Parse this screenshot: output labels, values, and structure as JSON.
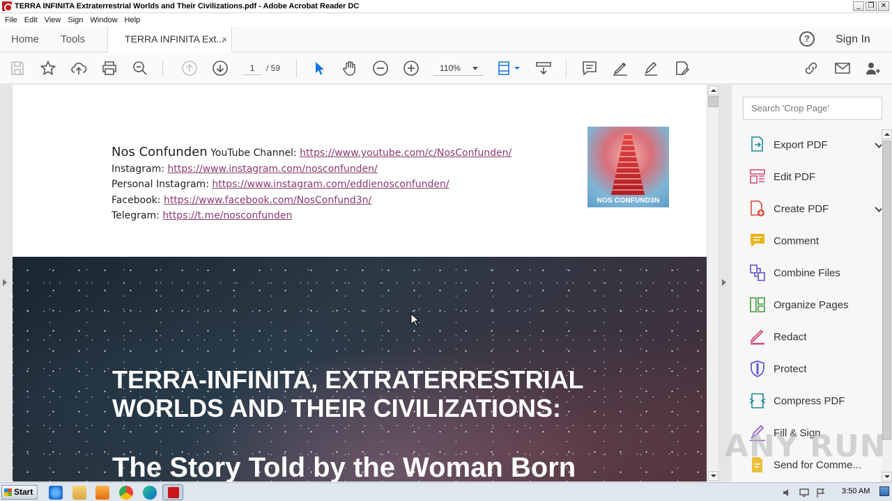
{
  "window": {
    "title": "TERRA INFINITA Extraterrestrial Worlds and Their Civilizations.pdf - Adobe Acrobat Reader DC",
    "buttons": {
      "minimize": "_",
      "restore": "❐",
      "close": "✕"
    }
  },
  "menu": [
    "File",
    "Edit",
    "View",
    "Sign",
    "Window",
    "Help"
  ],
  "tabs": {
    "home": "Home",
    "tools": "Tools",
    "document": "TERRA INFINITA Ext...",
    "close_glyph": "×"
  },
  "header": {
    "help_glyph": "?",
    "sign_in": "Sign In"
  },
  "toolbar": {
    "page_current": "1",
    "page_total": "/ 59",
    "zoom": "110%",
    "icons": [
      "save-icon",
      "bookmark-star-icon",
      "upload-cloud-icon",
      "print-icon",
      "zoom-search-icon",
      "page-up-icon",
      "page-down-icon",
      "select-arrow-icon",
      "hand-icon",
      "zoom-out-icon",
      "zoom-in-icon",
      "fit-page-icon",
      "scroll-mode-icon",
      "comment-icon",
      "highlight-icon",
      "sign-icon",
      "share-edit-icon",
      "link-icon",
      "email-icon",
      "add-user-icon"
    ]
  },
  "document": {
    "brand": "Nos Confunden",
    "youtube_label": " YouTube Channel: ",
    "youtube_url": "https://www.youtube.com/c/NosConfunden/",
    "instagram_label": "Instagram: ",
    "instagram_url": "https://www.instagram.com/nosconfunden/",
    "personal_instagram_label": "Personal Instagram: ",
    "personal_instagram_url": "https://www.instagram.com/eddienosconfunden/",
    "facebook_label": "Facebook: ",
    "facebook_url": "https://www.facebook.com/NosConfund3n/",
    "telegram_label": "Telegram: ",
    "telegram_url": "https://t.me/nosconfunden",
    "logo_text": "NOS CONFUND3N",
    "cover_title_line1": "TERRA-INFINITA, EXTRATERRESTRIAL",
    "cover_title_line2": "WORLDS AND THEIR CIVILIZATIONS:",
    "cover_subtitle": "The Story Told by the Woman Born"
  },
  "right_panel": {
    "search_placeholder": "Search 'Crop Page'",
    "tools": [
      {
        "label": "Export PDF",
        "icon": "export-pdf-icon",
        "color": "#1a8a9a",
        "expandable": true
      },
      {
        "label": "Edit PDF",
        "icon": "edit-pdf-icon",
        "color": "#d2477a",
        "expandable": false
      },
      {
        "label": "Create PDF",
        "icon": "create-pdf-icon",
        "color": "#e0463f",
        "expandable": true
      },
      {
        "label": "Comment",
        "icon": "comment-icon",
        "color": "#e8b51a",
        "expandable": false
      },
      {
        "label": "Combine Files",
        "icon": "combine-files-icon",
        "color": "#5a4fcf",
        "expandable": false
      },
      {
        "label": "Organize Pages",
        "icon": "organize-pages-icon",
        "color": "#3f9a3a",
        "expandable": false
      },
      {
        "label": "Redact",
        "icon": "redact-icon",
        "color": "#d2477a",
        "expandable": false
      },
      {
        "label": "Protect",
        "icon": "protect-icon",
        "color": "#5a5ad0",
        "expandable": false
      },
      {
        "label": "Compress PDF",
        "icon": "compress-pdf-icon",
        "color": "#1a8a9a",
        "expandable": false
      },
      {
        "label": "Fill & Sign",
        "icon": "fill-sign-icon",
        "color": "#8a4fcf",
        "expandable": false
      },
      {
        "label": "Send for Comme...",
        "icon": "send-comments-icon",
        "color": "#e8b51a",
        "expandable": false
      }
    ]
  },
  "watermark": "ANY RUN",
  "taskbar": {
    "start": "Start",
    "apps": [
      "internet-explorer-icon",
      "file-explorer-icon",
      "media-player-icon",
      "chrome-icon",
      "edge-icon",
      "acrobat-reader-icon"
    ],
    "clock": "3:50 AM"
  },
  "colors": {
    "link": "#8a3b6e",
    "accent": "#1473e6"
  }
}
